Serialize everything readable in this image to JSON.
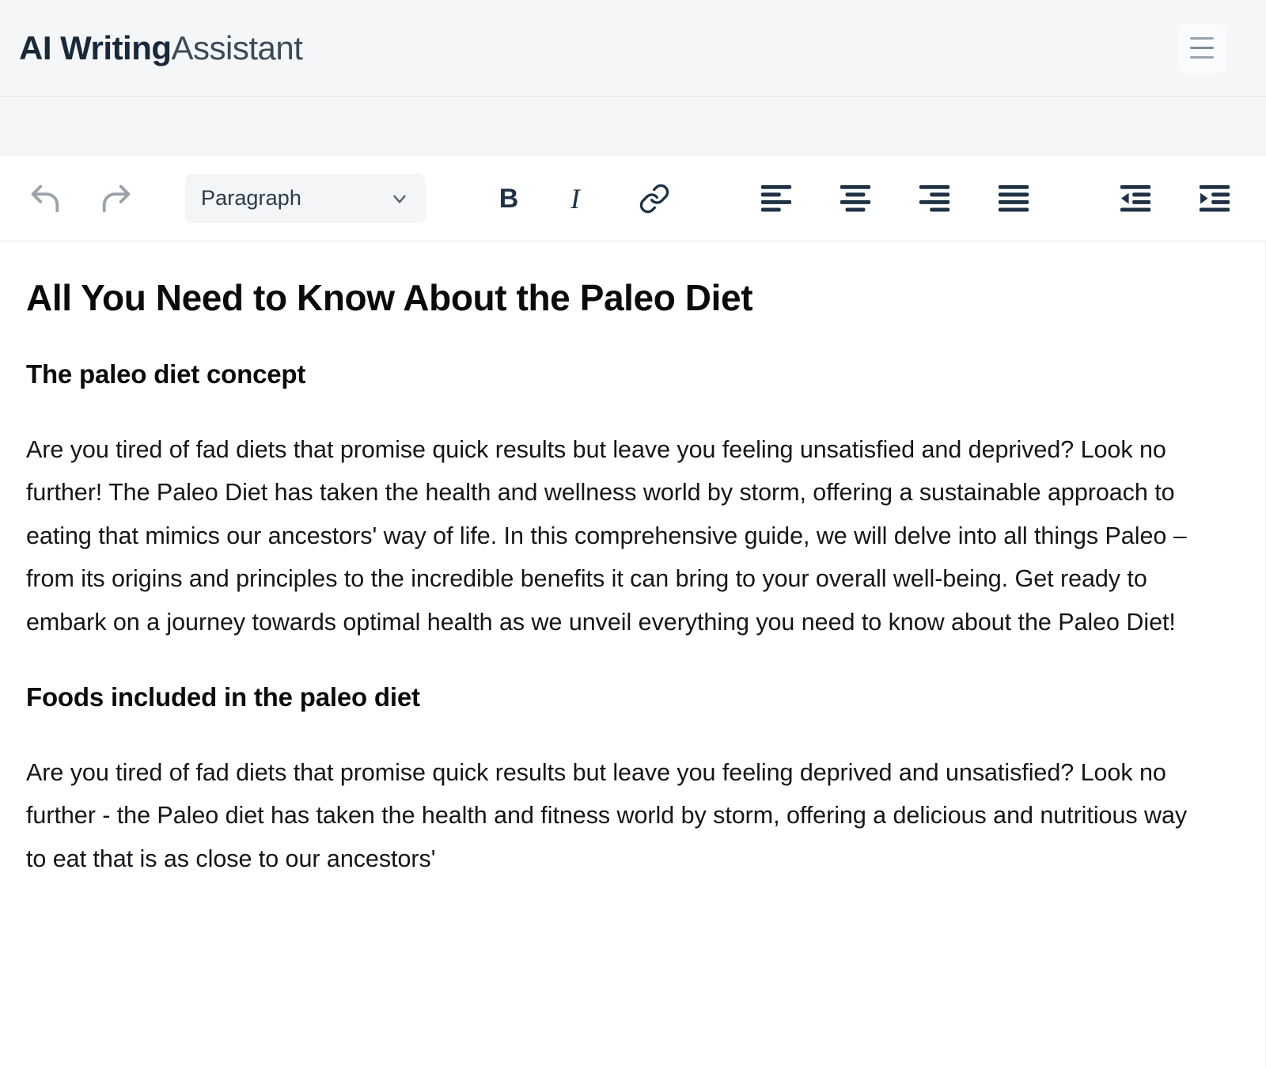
{
  "header": {
    "brand_strong": "AI Writing",
    "brand_light": "Assistant",
    "menu_icon": "hamburger-menu-icon"
  },
  "toolbar": {
    "undo_label": "undo-icon",
    "redo_label": "redo-icon",
    "format_select": {
      "value": "Paragraph",
      "chevron_icon": "chevron-down-icon"
    },
    "bold_label": "B",
    "italic_label": "I",
    "link_icon": "link-icon",
    "align_left_icon": "align-left-icon",
    "align_center_icon": "align-center-icon",
    "align_right_icon": "align-right-icon",
    "align_justify_icon": "align-justify-icon",
    "outdent_icon": "outdent-icon",
    "indent_icon": "indent-icon"
  },
  "document": {
    "title": "All You Need to Know About the Paleo Diet",
    "section_1_heading": "The paleo diet concept",
    "section_1_paragraph": "Are you tired of fad diets that promise quick results but leave you feeling unsatisfied and deprived? Look no further! The Paleo Diet has taken the health and wellness world by storm, offering a sustainable approach to eating that mimics our ancestors' way of life. In this comprehensive guide, we will delve into all things Paleo – from its origins and principles to the incredible benefits it can bring to your overall well-being. Get ready to embark on a journey towards optimal health as we unveil everything you need to know about the Paleo Diet!",
    "section_2_heading": "Foods included in the paleo diet",
    "section_2_paragraph": "Are you tired of fad diets that promise quick results but leave you feeling deprived and unsatisfied? Look no further - the Paleo diet has taken the health and fitness world by storm, offering a delicious and nutritious way to eat that is as close to our ancestors'"
  },
  "colors": {
    "brand_dark": "#17293b",
    "toolbar_icon": "#1e3145",
    "muted_icon": "#9aa3ac",
    "header_bg": "#f5f6f7",
    "select_bg": "#f4f5f7"
  }
}
